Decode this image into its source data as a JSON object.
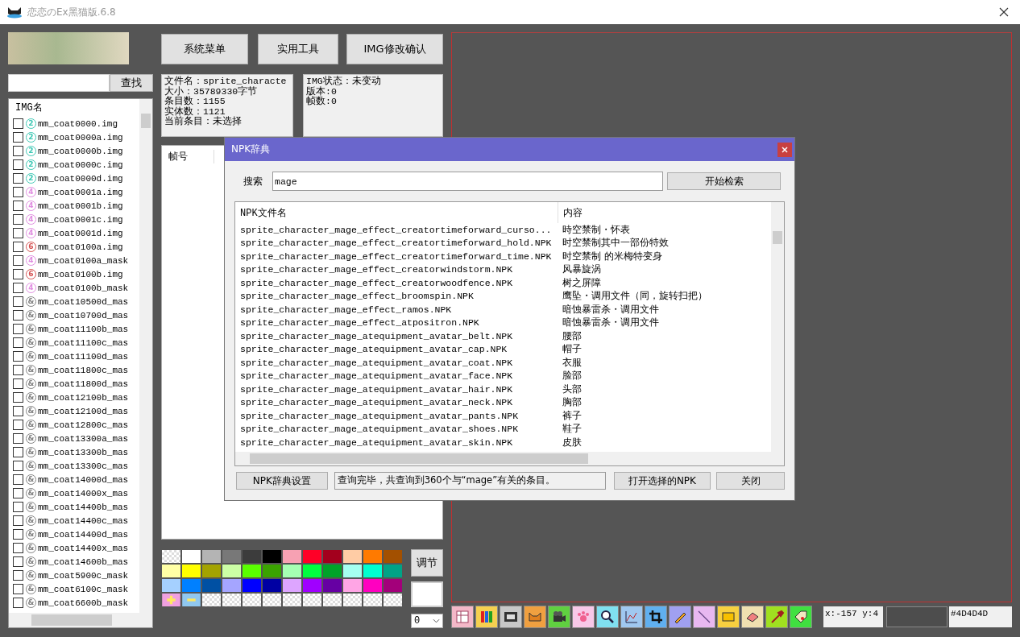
{
  "window": {
    "title": "恋恋のEx黑猫版.6.8"
  },
  "search": {
    "button": "查找"
  },
  "img_list": {
    "header": "IMG名",
    "items": [
      {
        "name": "mm_coat0000.img",
        "badge": "2",
        "color": "#3cc8b4",
        "checked": false
      },
      {
        "name": "mm_coat0000a.img",
        "badge": "2",
        "color": "#3cc8b4",
        "checked": false
      },
      {
        "name": "mm_coat0000b.img",
        "badge": "2",
        "color": "#3cc8b4",
        "checked": false
      },
      {
        "name": "mm_coat0000c.img",
        "badge": "2",
        "color": "#3cc8b4",
        "checked": false
      },
      {
        "name": "mm_coat0000d.img",
        "badge": "2",
        "color": "#3cc8b4",
        "checked": false
      },
      {
        "name": "mm_coat0001a.img",
        "badge": "4",
        "color": "#e08ce0",
        "checked": false
      },
      {
        "name": "mm_coat0001b.img",
        "badge": "4",
        "color": "#e08ce0",
        "checked": false
      },
      {
        "name": "mm_coat0001c.img",
        "badge": "4",
        "color": "#e08ce0",
        "checked": false
      },
      {
        "name": "mm_coat0001d.img",
        "badge": "4",
        "color": "#e08ce0",
        "checked": false
      },
      {
        "name": "mm_coat0100a.img",
        "badge": "6",
        "color": "#d45050",
        "checked": false
      },
      {
        "name": "mm_coat0100a_mask",
        "badge": "4",
        "color": "#e08ce0",
        "checked": false
      },
      {
        "name": "mm_coat0100b.img",
        "badge": "6",
        "color": "#d45050",
        "checked": false
      },
      {
        "name": "mm_coat0100b_mask",
        "badge": "4",
        "color": "#e08ce0",
        "checked": false
      },
      {
        "name": "mm_coat10500d_mas",
        "badge": "&",
        "color": "#808080",
        "checked": false
      },
      {
        "name": "mm_coat10700d_mas",
        "badge": "&",
        "color": "#808080",
        "checked": false
      },
      {
        "name": "mm_coat11100b_mas",
        "badge": "&",
        "color": "#808080",
        "checked": false
      },
      {
        "name": "mm_coat11100c_mas",
        "badge": "&",
        "color": "#808080",
        "checked": false
      },
      {
        "name": "mm_coat11100d_mas",
        "badge": "&",
        "color": "#808080",
        "checked": false
      },
      {
        "name": "mm_coat11800c_mas",
        "badge": "&",
        "color": "#808080",
        "checked": false
      },
      {
        "name": "mm_coat11800d_mas",
        "badge": "&",
        "color": "#808080",
        "checked": false
      },
      {
        "name": "mm_coat12100b_mas",
        "badge": "&",
        "color": "#808080",
        "checked": false
      },
      {
        "name": "mm_coat12100d_mas",
        "badge": "&",
        "color": "#808080",
        "checked": false
      },
      {
        "name": "mm_coat12800c_mas",
        "badge": "&",
        "color": "#808080",
        "checked": false
      },
      {
        "name": "mm_coat13300a_mas",
        "badge": "&",
        "color": "#808080",
        "checked": false
      },
      {
        "name": "mm_coat13300b_mas",
        "badge": "&",
        "color": "#808080",
        "checked": false
      },
      {
        "name": "mm_coat13300c_mas",
        "badge": "&",
        "color": "#808080",
        "checked": false
      },
      {
        "name": "mm_coat14000d_mas",
        "badge": "&",
        "color": "#808080",
        "checked": false
      },
      {
        "name": "mm_coat14000x_mas",
        "badge": "&",
        "color": "#808080",
        "checked": false
      },
      {
        "name": "mm_coat14400b_mas",
        "badge": "&",
        "color": "#808080",
        "checked": false
      },
      {
        "name": "mm_coat14400c_mas",
        "badge": "&",
        "color": "#808080",
        "checked": false
      },
      {
        "name": "mm_coat14400d_mas",
        "badge": "&",
        "color": "#808080",
        "checked": false
      },
      {
        "name": "mm_coat14400x_mas",
        "badge": "&",
        "color": "#808080",
        "checked": false
      },
      {
        "name": "mm_coat14600b_mas",
        "badge": "&",
        "color": "#808080",
        "checked": false
      },
      {
        "name": "mm_coat5900c_mask",
        "badge": "&",
        "color": "#808080",
        "checked": false
      },
      {
        "name": "mm_coat6100c_mask",
        "badge": "&",
        "color": "#808080",
        "checked": false
      },
      {
        "name": "mm_coat6600b_mask",
        "badge": "&",
        "color": "#808080",
        "checked": false
      }
    ]
  },
  "menu_buttons": [
    "系统菜单",
    "实用工具",
    "IMG修改确认"
  ],
  "file_info": [
    "文件名：sprite_characte",
    "大小：35789330字节",
    "条目数：1155",
    "实体数：1121",
    "当前条目：未选择"
  ],
  "img_info": [
    "IMG状态：未变动",
    "版本:0",
    "帧数:0"
  ],
  "frame_list": {
    "header": "帧号"
  },
  "palette": [
    {
      "kind": "empty"
    },
    {
      "kind": "color",
      "color": "#ffffff"
    },
    {
      "kind": "color",
      "color": "#b4b4b4"
    },
    {
      "kind": "color",
      "color": "#787878"
    },
    {
      "kind": "color",
      "color": "#3c3c3c"
    },
    {
      "kind": "color",
      "color": "#000000"
    },
    {
      "kind": "color",
      "color": "#f7a1b3"
    },
    {
      "kind": "color",
      "color": "#ff0027"
    },
    {
      "kind": "color",
      "color": "#a3001d"
    },
    {
      "kind": "color",
      "color": "#ffcca5"
    },
    {
      "kind": "color",
      "color": "#ff7a00"
    },
    {
      "kind": "color",
      "color": "#a35000"
    },
    {
      "kind": "color",
      "color": "#ffffa5"
    },
    {
      "kind": "color",
      "color": "#ffff00"
    },
    {
      "kind": "color",
      "color": "#a3a300"
    },
    {
      "kind": "color",
      "color": "#ccffa5"
    },
    {
      "kind": "color",
      "color": "#5aff00"
    },
    {
      "kind": "color",
      "color": "#3aa300"
    },
    {
      "kind": "color",
      "color": "#a5ffb3"
    },
    {
      "kind": "color",
      "color": "#00ff40"
    },
    {
      "kind": "color",
      "color": "#00a329"
    },
    {
      "kind": "color",
      "color": "#a5fff0"
    },
    {
      "kind": "color",
      "color": "#00ffd0"
    },
    {
      "kind": "color",
      "color": "#00a386"
    },
    {
      "kind": "color",
      "color": "#a5d0ff"
    },
    {
      "kind": "color",
      "color": "#0080ff"
    },
    {
      "kind": "color",
      "color": "#0050a3"
    },
    {
      "kind": "color",
      "color": "#a5a5ff"
    },
    {
      "kind": "color",
      "color": "#0000ff"
    },
    {
      "kind": "color",
      "color": "#0000a3"
    },
    {
      "kind": "color",
      "color": "#dda5ff"
    },
    {
      "kind": "color",
      "color": "#a000ff"
    },
    {
      "kind": "color",
      "color": "#6600a3"
    },
    {
      "kind": "color",
      "color": "#ffa5e5"
    },
    {
      "kind": "color",
      "color": "#ff00c0"
    },
    {
      "kind": "color",
      "color": "#a3007a"
    },
    {
      "kind": "add"
    },
    {
      "kind": "remove"
    },
    {
      "kind": "empty"
    },
    {
      "kind": "empty"
    },
    {
      "kind": "empty"
    },
    {
      "kind": "empty"
    },
    {
      "kind": "empty"
    },
    {
      "kind": "empty"
    },
    {
      "kind": "empty"
    },
    {
      "kind": "empty"
    },
    {
      "kind": "empty"
    },
    {
      "kind": "empty"
    }
  ],
  "adjust_button": "调节",
  "layer_select": {
    "value": "0"
  },
  "status": {
    "coords": "x:-157 y:4",
    "color_hex": "#4D4D4D"
  },
  "dialog": {
    "title": "NPK辞典",
    "search_label": "搜索",
    "search_value": "mage",
    "search_button": "开始检索",
    "columns": [
      "NPK文件名",
      "内容"
    ],
    "rows": [
      [
        "sprite_character_mage_effect_creatortimeforward_curso...",
        "時空禁制・怀表"
      ],
      [
        "sprite_character_mage_effect_creatortimeforward_hold.NPK",
        "时空禁制其中一部份特效"
      ],
      [
        "sprite_character_mage_effect_creatortimeforward_time.NPK",
        "时空禁制 的米梅特变身"
      ],
      [
        "sprite_character_mage_effect_creatorwindstorm.NPK",
        "风暴旋涡"
      ],
      [
        "sprite_character_mage_effect_creatorwoodfence.NPK",
        "树之屏障"
      ],
      [
        "sprite_character_mage_effect_broomspin.NPK",
        "鹰坠・调用文件（同，旋转扫把）"
      ],
      [
        "sprite_character_mage_effect_ramos.NPK",
        "暗蚀暴雷杀・调用文件"
      ],
      [
        "sprite_character_mage_effect_atpositron.NPK",
        "暗蚀暴雷杀・调用文件"
      ],
      [
        "sprite_character_mage_atequipment_avatar_belt.NPK",
        "腰部"
      ],
      [
        "sprite_character_mage_atequipment_avatar_cap.NPK",
        "帽子"
      ],
      [
        "sprite_character_mage_atequipment_avatar_coat.NPK",
        "衣服"
      ],
      [
        "sprite_character_mage_atequipment_avatar_face.NPK",
        "脸部"
      ],
      [
        "sprite_character_mage_atequipment_avatar_hair.NPK",
        "头部"
      ],
      [
        "sprite_character_mage_atequipment_avatar_neck.NPK",
        "胸部"
      ],
      [
        "sprite_character_mage_atequipment_avatar_pants.NPK",
        "裤子"
      ],
      [
        "sprite_character_mage_atequipment_avatar_shoes.NPK",
        "鞋子"
      ],
      [
        "sprite_character_mage_atequipment_avatar_skin.NPK",
        "皮肤"
      ]
    ],
    "settings_button": "NPK辞典设置",
    "result": "查询完毕，共查询到360个与“mage”有关的条目。",
    "open_button": "打开选择的NPK",
    "close_button": "关闭"
  }
}
